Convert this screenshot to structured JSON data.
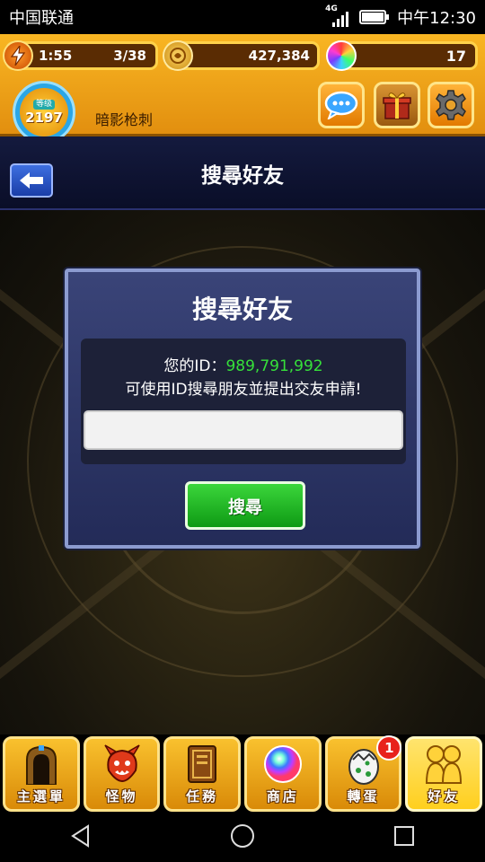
{
  "status_bar": {
    "carrier": "中国联通",
    "network": "4G",
    "time": "中午12:30"
  },
  "header": {
    "stamina_timer": "1:55",
    "stamina": "3/38",
    "gold": "427,384",
    "orbs": "17",
    "rank_badge": "等级",
    "level": "2197",
    "username": "暗影枪刺"
  },
  "page": {
    "title": "搜尋好友"
  },
  "dialog": {
    "title": "搜尋好友",
    "id_label": "您的ID：",
    "id_value": "989,791,992",
    "hint": "可使用ID搜尋朋友並提出交友申請!",
    "input_value": "",
    "input_placeholder": "",
    "search_button": "搜尋"
  },
  "bottom_nav": [
    {
      "label": "主選單",
      "icon": "gate-icon"
    },
    {
      "label": "怪物",
      "icon": "monster-icon"
    },
    {
      "label": "任務",
      "icon": "quest-book-icon"
    },
    {
      "label": "商店",
      "icon": "rainbow-orb-icon"
    },
    {
      "label": "轉蛋",
      "icon": "egg-icon",
      "badge": "1"
    },
    {
      "label": "好友",
      "icon": "friends-icon",
      "active": true
    }
  ],
  "colors": {
    "header_gold": "#f9b623",
    "dialog_bg": "#2f3868",
    "id_green": "#36e03a",
    "search_green": "#1fb523"
  }
}
